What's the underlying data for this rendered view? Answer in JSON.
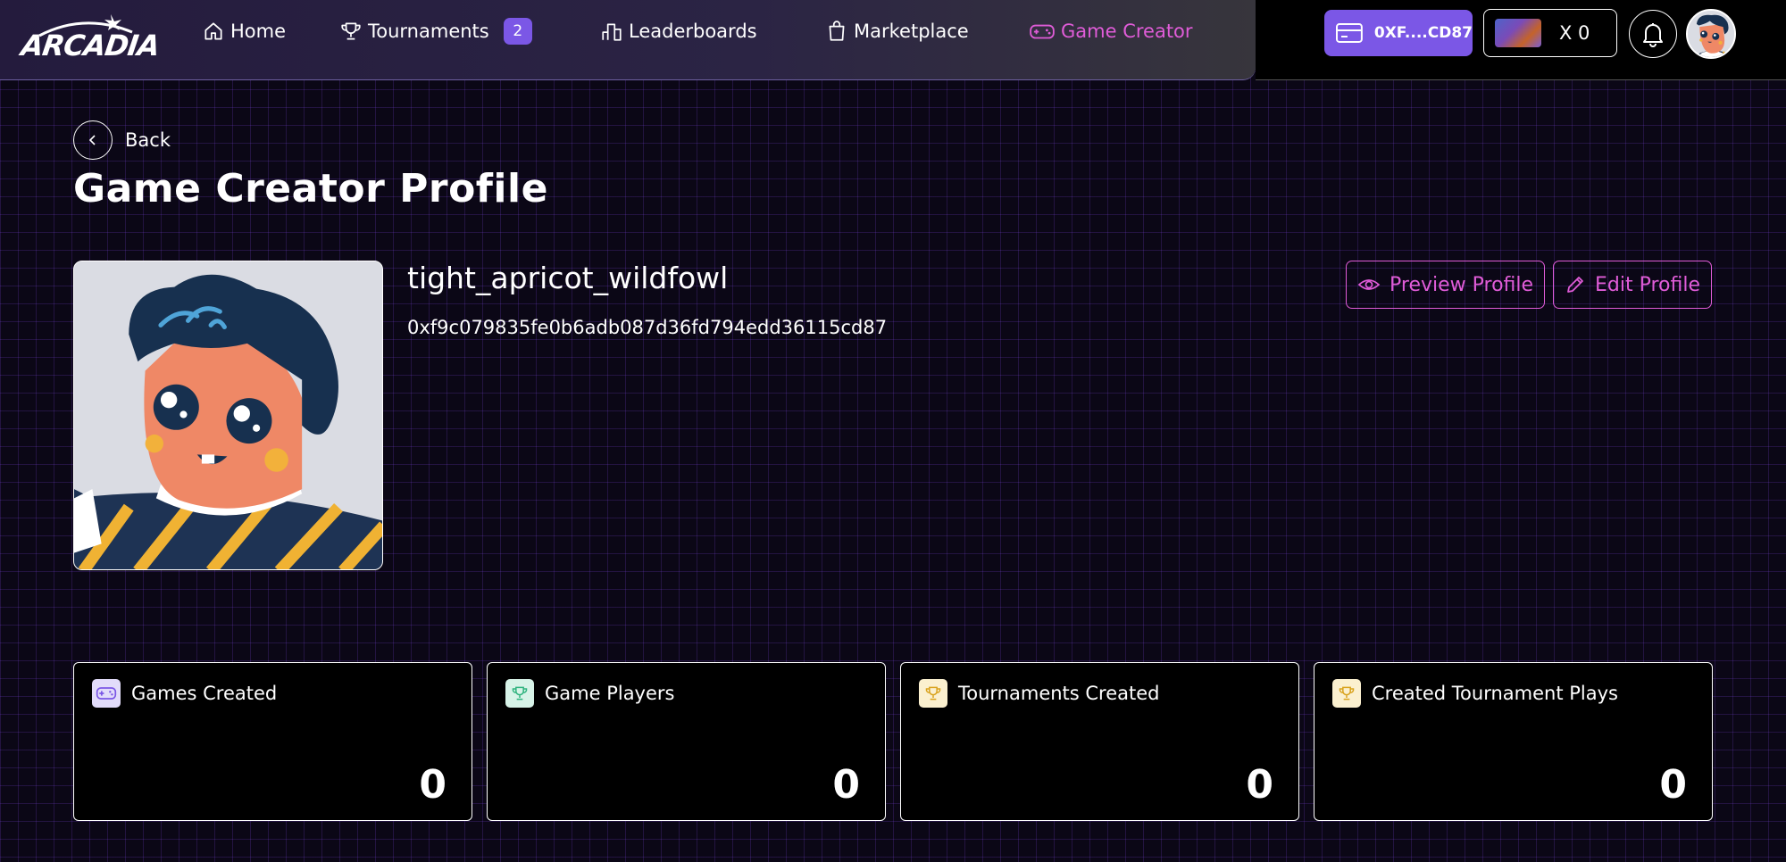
{
  "brand": {
    "logo_text": "ARCADIA"
  },
  "nav": {
    "items": [
      {
        "label": "Home",
        "icon": "home-icon"
      },
      {
        "label": "Tournaments",
        "icon": "trophy-icon",
        "badge": "2"
      },
      {
        "label": "Leaderboards",
        "icon": "leaderboard-icon"
      },
      {
        "label": "Marketplace",
        "icon": "shopping-bag-icon"
      },
      {
        "label": "Game Creator",
        "icon": "gamepad-icon",
        "active": true
      }
    ],
    "active_color": "#e05cd8"
  },
  "header": {
    "wallet_label": "0XF....CD87",
    "coin_count": "X 0",
    "accent_color": "#7b57e6"
  },
  "main": {
    "back_label": "Back",
    "page_title": "Game Creator Profile",
    "profile": {
      "username": "tight_apricot_wildfowl",
      "address": "0xf9c079835fe0b6adb087d36fd794edd36115cd87",
      "preview_label": "Preview Profile",
      "edit_label": "Edit Profile"
    },
    "stats": [
      {
        "label": "Games Created",
        "value": "0",
        "icon": "gamepad-icon"
      },
      {
        "label": "Game Players",
        "value": "0",
        "icon": "trophy-icon"
      },
      {
        "label": "Tournaments Created",
        "value": "0",
        "icon": "trophy-icon"
      },
      {
        "label": "Created Tournament Plays",
        "value": "0",
        "icon": "trophy-icon"
      }
    ]
  }
}
